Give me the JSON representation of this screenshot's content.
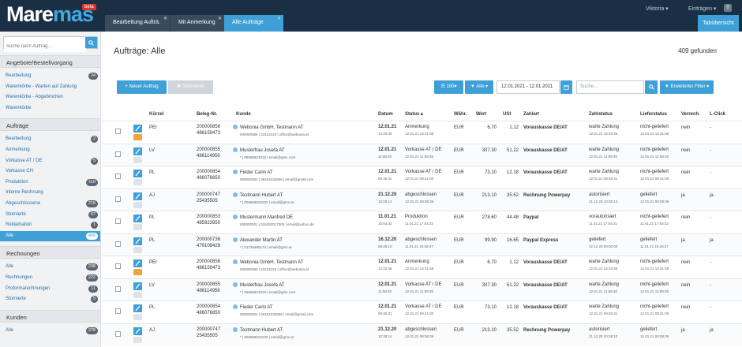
{
  "app": {
    "logo_text_a": "Mare",
    "logo_text_b": "mas",
    "badge": "beta"
  },
  "tabs": [
    {
      "label": "Bearbeitung Aufträ."
    },
    {
      "label": "Mit Anmerkung"
    },
    {
      "label": "Alle Aufträge"
    }
  ],
  "topbar": {
    "user": "Viktoria ▾",
    "settings": "Einträgen ▾",
    "notifications": "0",
    "overview": "Tabübersicht"
  },
  "sidebar": {
    "search_placeholder": "Suche nach Auftrag…",
    "sections": [
      {
        "title": "Angebote/Bestellvorgang",
        "items": [
          {
            "label": "Bearbeitung",
            "count": "24"
          },
          {
            "label": "Warenkörbe - Warten auf Zahlung",
            "count": ""
          },
          {
            "label": "Warenkörbe - Abgebrochen",
            "count": ""
          },
          {
            "label": "Warenkörbe",
            "count": ""
          }
        ]
      },
      {
        "title": "Aufträge",
        "items": [
          {
            "label": "Bearbeitung",
            "count": "2"
          },
          {
            "label": "Anmerkung",
            "count": ""
          },
          {
            "label": "Vorkasse AT / DE",
            "count": "5"
          },
          {
            "label": "Vorkasse CH",
            "count": ""
          },
          {
            "label": "Produktion",
            "count": "110"
          },
          {
            "label": "Interne Rechnung",
            "count": ""
          },
          {
            "label": "Abgeschlossene",
            "count": "219"
          },
          {
            "label": "Stornierte",
            "count": "67"
          },
          {
            "label": "Reklamation",
            "count": "1"
          },
          {
            "label": "Alle",
            "count": "409"
          }
        ]
      },
      {
        "title": "Rechnungen",
        "items": [
          {
            "label": "Alle",
            "count": "238"
          },
          {
            "label": "Rechnungen",
            "count": "222"
          },
          {
            "label": "Proformarechnungen",
            "count": "11"
          },
          {
            "label": "Stornierte",
            "count": "5"
          }
        ]
      },
      {
        "title": "Kunden",
        "items": [
          {
            "label": "Alle",
            "count": "378"
          }
        ]
      }
    ]
  },
  "main": {
    "title": "Aufträge: Alle",
    "found": "409 gefunden",
    "new_order": "+ Neuer Auftrag",
    "cancel": "✖ Stornieren",
    "per_page": "☰ 100▾",
    "filter": "▼ Alle ▾",
    "date_range": "12.01.2021 - 12.01.2021",
    "search_placeholder": "Suche...",
    "adv_filter": "▼ Erweiterter Filter ▾",
    "columns": [
      "Kürzel",
      "Beleg-Nr.",
      "Kunde",
      "Datum",
      "Status▲",
      "Währ.",
      "Wert",
      "USt",
      "Zahlart",
      "Zahlstatus",
      "Lieferstatus",
      "Verrech.",
      "L-Click"
    ],
    "rows": [
      {
        "kurz": "PEr",
        "beleg": "200000856",
        "beleg2": "486159473",
        "kunde": "Webonia GmbH, Testmann AT",
        "kunde2": "000000356 | 23123123 | office@webonia.at",
        "datum": "12.01.21",
        "zeit": "14:33:46",
        "status": "Anmerkung",
        "status2": "12.01.21 14:31:58",
        "waehr": "EUR",
        "wert": "6.70",
        "ust": "1.12",
        "zahlart": "Vorauskasse DE/AT",
        "zstat": "warte Zahlung",
        "zstat2": "12.01.21 14:33:46",
        "lstat": "nicht-geliefert",
        "lstat2": "12.01.21 14:31:58",
        "verr": "nein",
        "lclick": "-",
        "note": "#f2a33c"
      },
      {
        "kurz": "LV",
        "beleg": "200000855",
        "beleg2": "486114956",
        "kunde": "Musterfrau Josefa AT",
        "kunde2": "* | 06069623319 | email@gmx.com",
        "datum": "12.01.21",
        "zeit": "11:58:40",
        "status": "Vorkasse AT / DE",
        "status2": "12.01.21 11:59:35",
        "waehr": "EUR",
        "wert": "307.30",
        "ust": "51.22",
        "zahlart": "Vorauskasse DE/AT",
        "zstat": "warte Zahlung",
        "zstat2": "12.01.21 11:58:40",
        "lstat": "nicht-geliefert",
        "lstat2": "12.01.21 11:59:35",
        "verr": "nein",
        "lclick": "-",
        "note": "#dfe3e7"
      },
      {
        "kurz": "PL",
        "beleg": "200000854",
        "beleg2": "486076850",
        "kunde": "Fieder Carlo AT",
        "kunde2": "000000354 | 06421033668 | email@gmail.com",
        "datum": "12.01.21",
        "zeit": "09:46:31",
        "status": "Vorkasse AT / DE",
        "status2": "12.01.21 09:41:00",
        "waehr": "EUR",
        "wert": "73.10",
        "ust": "12.18",
        "zahlart": "Vorauskasse DE/AT",
        "zstat": "warte Zahlung",
        "zstat2": "12.01.21 09:46:31",
        "lstat": "nicht-geliefert",
        "lstat2": "12.01.21 09:41:00",
        "verr": "nein",
        "lclick": "-",
        "note": "#dfe3e7"
      },
      {
        "kurz": "AJ",
        "beleg": "200000747",
        "beleg2": "25435505",
        "kunde": "Testmann Hubert AT",
        "kunde2": "* | 006669622232 | email@gmx.at",
        "datum": "21.12.20",
        "zeit": "10:28:14",
        "status": "abgeschlossen",
        "status2": "12.01.21 08:08:36",
        "waehr": "EUR",
        "wert": "213.10",
        "ust": "35.52",
        "zahlart": "Rechnung Powerpay",
        "zstat": "autorisiert",
        "zstat2": "21.12.20 10:28:13",
        "lstat": "geliefert",
        "lstat2": "12.01.21 08:08:36",
        "verr": "ja",
        "lclick": "ja",
        "note": "#dfe3e7"
      },
      {
        "kurz": "PL",
        "beleg": "200000853",
        "beleg2": "485923950",
        "kunde": "Mustermann Manfred DE",
        "kunde2": "000000001 | 016282017000 | email@yahoo.de",
        "datum": "11.01.21",
        "zeit": "15:54:32",
        "status": "Produktion",
        "status2": "11.01.21 17:54:22",
        "waehr": "EUR",
        "wert": "278.60",
        "ust": "44.48",
        "zahlart": "Paypal",
        "zstat": "vorautorisiert",
        "zstat2": "11.01.21 17:54:21",
        "lstat": "nicht-geliefert",
        "lstat2": "11.01.21 17:54:22",
        "verr": "nein",
        "lclick": "-",
        "note": "#dfe3e7"
      },
      {
        "kurz": "PL",
        "beleg": "200000736",
        "beleg2": "479109428",
        "kunde": "Alexander Martin AT",
        "kunde2": "* | 01725490174 | email@gmx.at",
        "datum": "16.12.20",
        "zeit": "09:46:10",
        "status": "abgeschlossen",
        "status2": "11.01.21 16:46:47",
        "waehr": "EUR",
        "wert": "99.90",
        "ust": "16.65",
        "zahlart": "Paypal Express",
        "zstat": "geliefert",
        "zstat2": "22.12.20 00:00:00",
        "lstat": "geliefert",
        "lstat2": "11.01.21 16:46:47",
        "verr": "ja",
        "lclick": "ja",
        "note": "#dfe3e7"
      },
      {
        "kurz": "PEr",
        "beleg": "200000856",
        "beleg2": "486159473",
        "kunde": "Webonia GmbH, Testmann AT",
        "kunde2": "000000356 | 23123123 | office@webonia.at",
        "datum": "12.01.21",
        "zeit": "14:33:46",
        "status": "Anmerkung",
        "status2": "12.01.21 14:31:58",
        "waehr": "EUR",
        "wert": "6.70",
        "ust": "1.12",
        "zahlart": "Vorauskasse DE/AT",
        "zstat": "warte Zahlung",
        "zstat2": "12.01.21 14:33:46",
        "lstat": "nicht-geliefert",
        "lstat2": "12.01.21 14:31:58",
        "verr": "nein",
        "lclick": "-",
        "note": "#f2a33c"
      },
      {
        "kurz": "LV",
        "beleg": "200000855",
        "beleg2": "486114956",
        "kunde": "Musterfrau Josefa AT",
        "kunde2": "* | 06069623319 | email@gmx.com",
        "datum": "12.01.21",
        "zeit": "11:58:40",
        "status": "Vorkasse AT / DE",
        "status2": "12.01.21 11:59:35",
        "waehr": "EUR",
        "wert": "307.30",
        "ust": "51.22",
        "zahlart": "Vorauskasse DE/AT",
        "zstat": "warte Zahlung",
        "zstat2": "12.01.21 11:58:40",
        "lstat": "nicht-geliefert",
        "lstat2": "12.01.21 11:59:35",
        "verr": "nein",
        "lclick": "-",
        "note": "#dfe3e7"
      },
      {
        "kurz": "PL",
        "beleg": "200000854",
        "beleg2": "486076850",
        "kunde": "Fieder Carlo AT",
        "kunde2": "000000354 | 06421033668 | email@gmail.com",
        "datum": "12.01.21",
        "zeit": "09:46:31",
        "status": "Vorkasse AT / DE",
        "status2": "12.01.21 09:41:00",
        "waehr": "EUR",
        "wert": "73.10",
        "ust": "12.18",
        "zahlart": "Vorauskasse DE/AT",
        "zstat": "warte Zahlung",
        "zstat2": "12.01.21 09:46:31",
        "lstat": "nicht-geliefert",
        "lstat2": "12.01.21 09:41:00",
        "verr": "nein",
        "lclick": "-",
        "note": "#dfe3e7"
      },
      {
        "kurz": "AJ",
        "beleg": "200000747",
        "beleg2": "25435505",
        "kunde": "Testmann Hubert AT",
        "kunde2": "* | 006669622232 | email@gmx.at",
        "datum": "21.12.20",
        "zeit": "10:28:14",
        "status": "abgeschlossen",
        "status2": "12.01.21 08:08:36",
        "waehr": "EUR",
        "wert": "213.10",
        "ust": "35.52",
        "zahlart": "Rechnung Powerpay",
        "zstat": "autorisiert",
        "zstat2": "21.12.20 10:28:13",
        "lstat": "geliefert",
        "lstat2": "12.01.21 08:08:36",
        "verr": "ja",
        "lclick": "ja",
        "note": "#dfe3e7"
      }
    ]
  }
}
